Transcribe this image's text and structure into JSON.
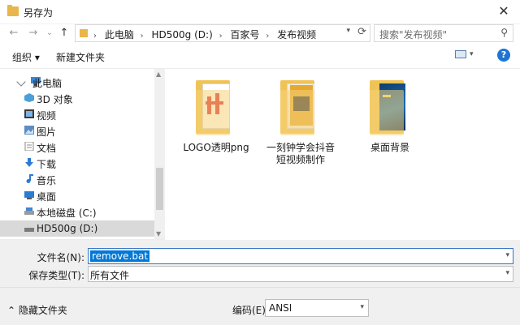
{
  "window": {
    "title": "另存为",
    "close": "✕"
  },
  "nav_buttons": {
    "back": "←",
    "forward": "→",
    "recent": "⌄",
    "up": "↑"
  },
  "address": {
    "crumbs": [
      "此电脑",
      "HD500g (D:)",
      "百家号",
      "发布视频"
    ],
    "separator": "›"
  },
  "search": {
    "placeholder": "搜索\"发布视频\""
  },
  "toolbar": {
    "organize": "组织 ▾",
    "new_folder": "新建文件夹",
    "help": "?"
  },
  "sidebar": {
    "items": [
      {
        "label": "此电脑",
        "icon": "computer-icon",
        "color": "#3b86d6",
        "expanded": true
      },
      {
        "label": "3D 对象",
        "icon": "cube-icon",
        "color": "#4a9fd8"
      },
      {
        "label": "视频",
        "icon": "video-icon",
        "color": "#3a3a3a"
      },
      {
        "label": "图片",
        "icon": "picture-icon",
        "color": "#5b8ec4"
      },
      {
        "label": "文档",
        "icon": "document-icon",
        "color": "#8a8a8a"
      },
      {
        "label": "下载",
        "icon": "download-icon",
        "color": "#2a7bd4"
      },
      {
        "label": "音乐",
        "icon": "music-icon",
        "color": "#2a7bd4"
      },
      {
        "label": "桌面",
        "icon": "desktop-icon",
        "color": "#2a7bd4"
      },
      {
        "label": "本地磁盘 (C:)",
        "icon": "drive-icon",
        "color": "#7a7a7a"
      },
      {
        "label": "HD500g (D:)",
        "icon": "drive-icon",
        "color": "#7a7a7a",
        "selected": true
      }
    ]
  },
  "files": [
    {
      "name": "LOGO透明png"
    },
    {
      "name": "一刻钟学会抖音短视频制作"
    },
    {
      "name": "桌面背景"
    }
  ],
  "form": {
    "filename_label": "文件名(N):",
    "filename_value": "remove.bat",
    "filetype_label": "保存类型(T):",
    "filetype_value": "所有文件"
  },
  "bottom": {
    "hide_folders": "⌃ 隐藏文件夹",
    "encoding_label": "编码(E):",
    "encoding_value": "ANSI"
  }
}
